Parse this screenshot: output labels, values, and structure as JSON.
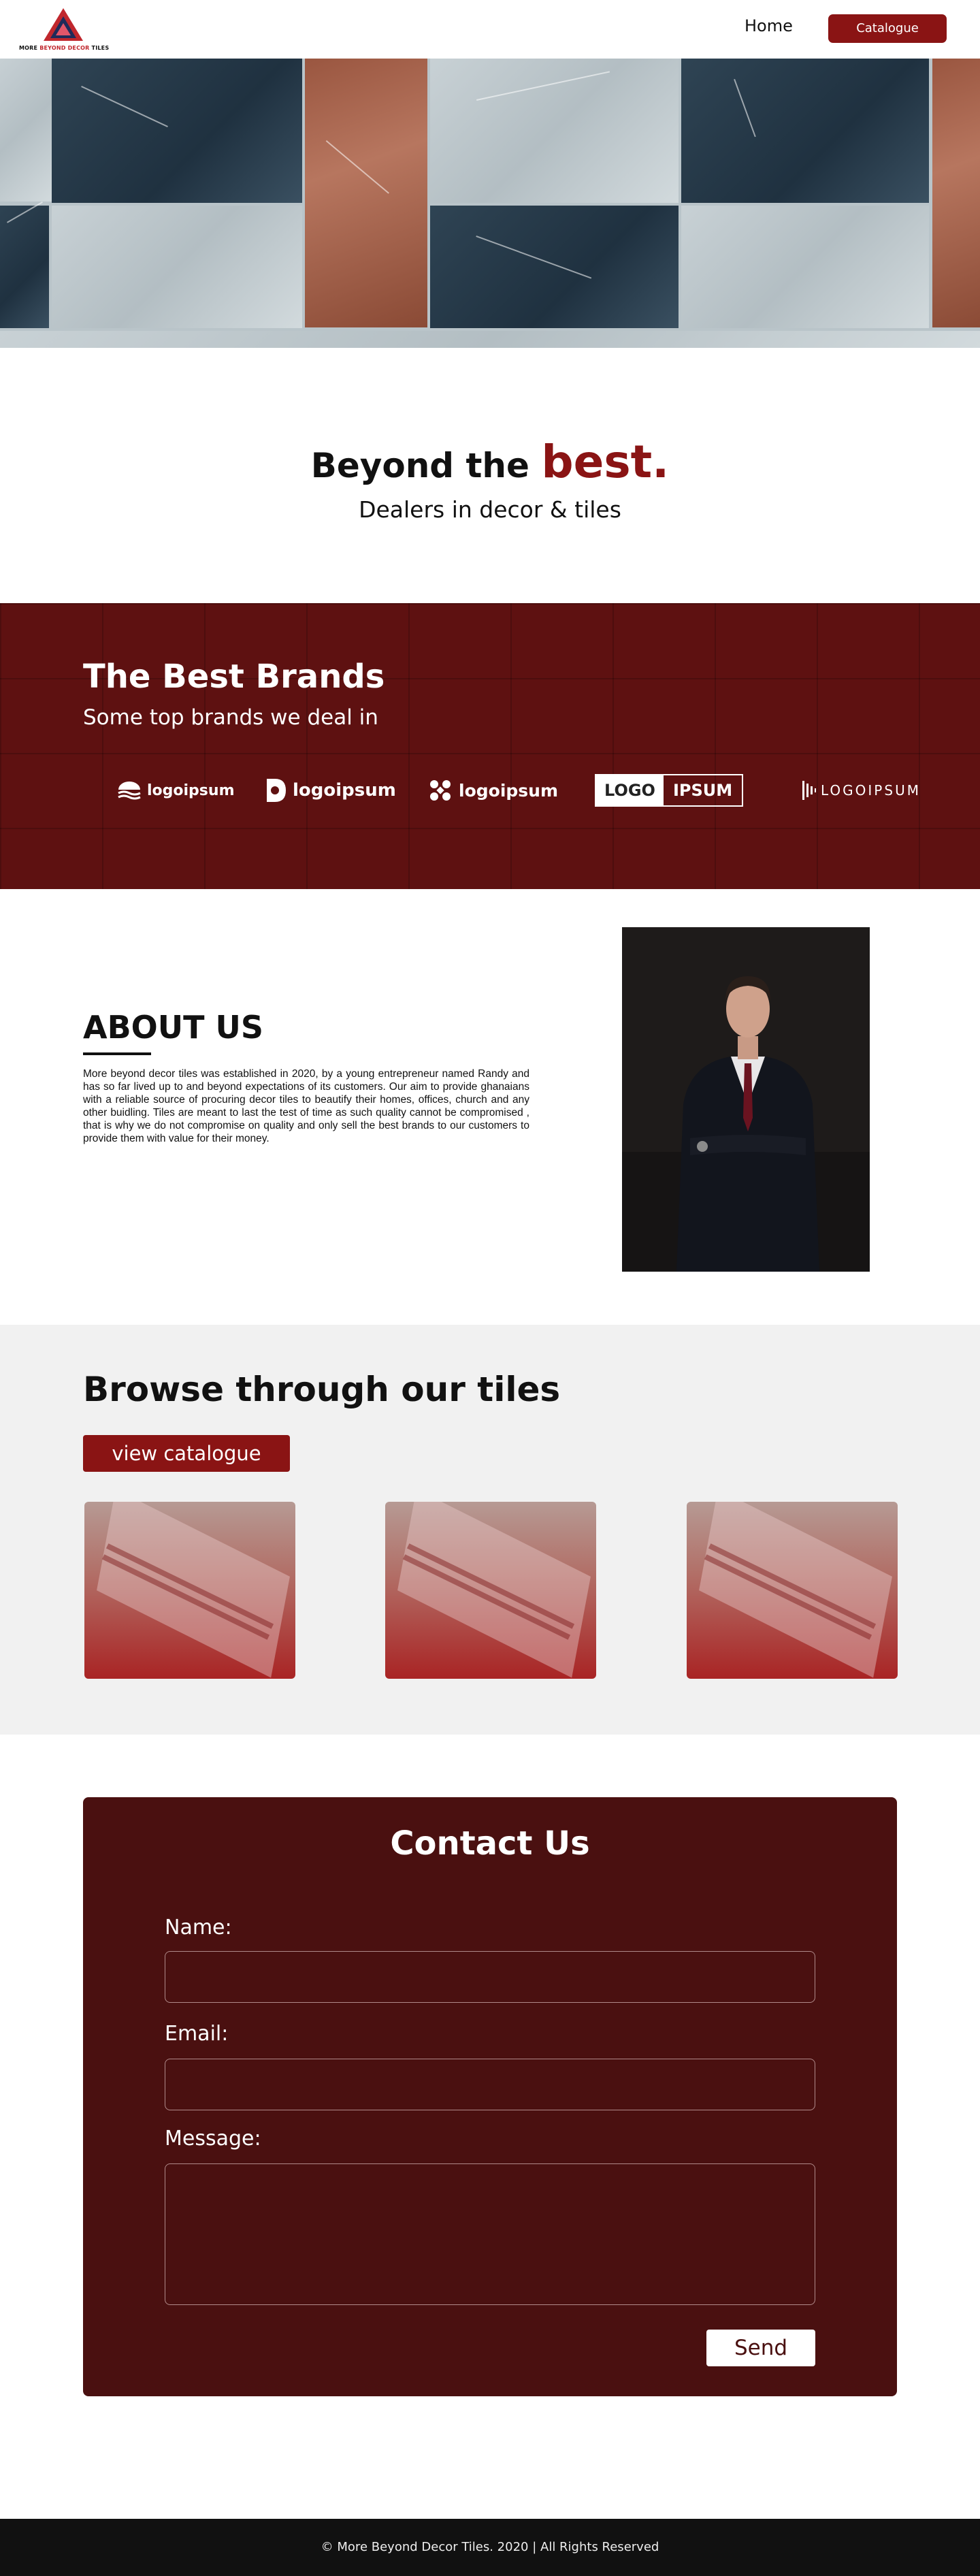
{
  "nav": {
    "logo_text_1": "MORE",
    "logo_text_2": "BEYOND DECOR",
    "logo_text_3": "TILES",
    "home": "Home",
    "catalogue": "Catalogue"
  },
  "tagline": {
    "lead": "Beyond the",
    "accent": "best.",
    "sub": "Dealers in decor & tiles"
  },
  "brands": {
    "title": "The Best Brands",
    "subtitle": "Some top brands we deal in",
    "logos": [
      "logoipsum",
      "logoipsum",
      "logoipsum",
      "LOGO",
      "IPSUM",
      "LOGOIPSUM"
    ]
  },
  "about": {
    "title": "ABOUT US",
    "text": "More beyond decor tiles was established in 2020, by a young entrepreneur named Randy  and has so far lived up to and beyond expectations of its customers. Our aim to provide ghanaians with a reliable source of procuring decor tiles to beautify their homes, offices, church and any other buidling. Tiles are meant to last the test of time as such quality cannot be compromised , that is why we do not compromise on quality and only sell the best brands to our customers to provide them with value for their money."
  },
  "tiles": {
    "title": "Browse through our tiles",
    "button": "view catalogue"
  },
  "contact": {
    "title": "Contact Us",
    "name_label": "Name:",
    "email_label": "Email:",
    "message_label": "Message:",
    "send": "Send"
  },
  "footer": {
    "text": "© More Beyond Decor Tiles. 2020 | All Rights Reserved"
  },
  "colors": {
    "accent": "#8a1414",
    "brands_bg": "#5e1111",
    "contact_bg": "#4a1010",
    "footer_bg": "#111111"
  }
}
